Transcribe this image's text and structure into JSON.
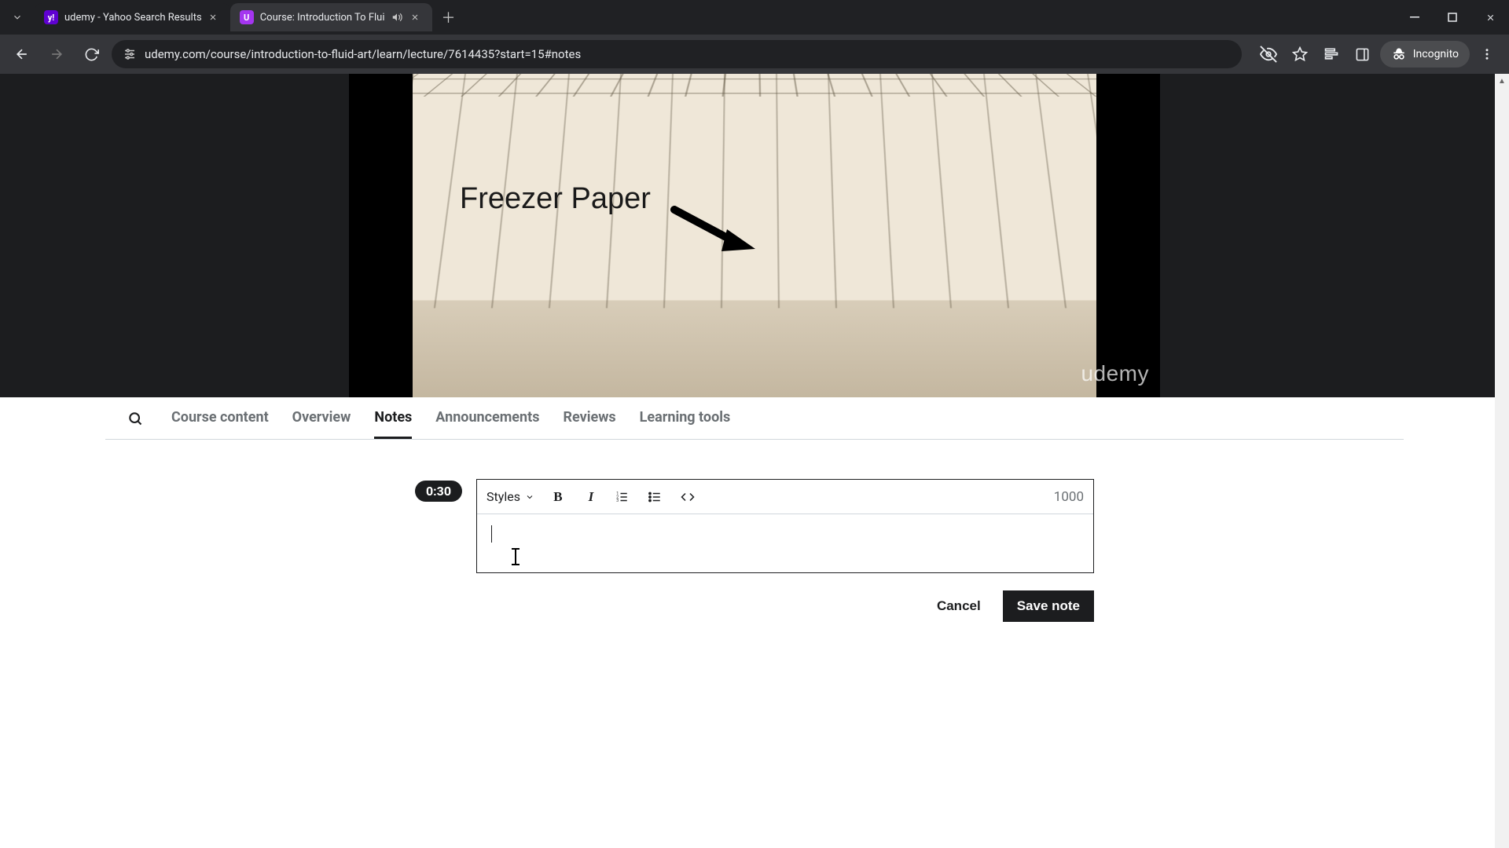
{
  "browser": {
    "tabs": [
      {
        "title": "udemy - Yahoo Search Results",
        "favicon": "y!",
        "active": false,
        "audio": false
      },
      {
        "title": "Course: Introduction To Flui",
        "favicon": "U",
        "active": true,
        "audio": true
      }
    ],
    "url": "udemy.com/course/introduction-to-fluid-art/learn/lecture/7614435?start=15#notes",
    "incognito_label": "Incognito"
  },
  "video": {
    "overlay_label": "Freezer Paper",
    "watermark": "udemy"
  },
  "course_tabs": {
    "items": [
      {
        "label": "Course content",
        "active": false
      },
      {
        "label": "Overview",
        "active": false
      },
      {
        "label": "Notes",
        "active": true
      },
      {
        "label": "Announcements",
        "active": false
      },
      {
        "label": "Reviews",
        "active": false
      },
      {
        "label": "Learning tools",
        "active": false
      }
    ]
  },
  "notes": {
    "timestamp": "0:30",
    "styles_label": "Styles",
    "char_count": "1000",
    "cancel_label": "Cancel",
    "save_label": "Save note"
  }
}
